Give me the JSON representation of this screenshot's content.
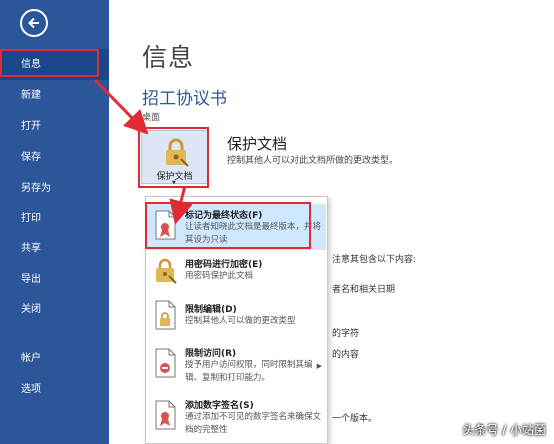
{
  "sidebar": {
    "back_icon": "back-arrow-icon",
    "items": [
      {
        "label": "信息",
        "active": true
      },
      {
        "label": "新建"
      },
      {
        "label": "打开"
      },
      {
        "label": "保存"
      },
      {
        "label": "另存为"
      },
      {
        "label": "打印"
      },
      {
        "label": "共享"
      },
      {
        "label": "导出"
      },
      {
        "label": "关闭"
      },
      {
        "label": "帐户"
      },
      {
        "label": "选项"
      }
    ]
  },
  "main": {
    "title": "信息",
    "document_title": "招工协议书",
    "location": "桌面",
    "protect": {
      "button_label": "保护文档",
      "heading": "保护文档",
      "description": "控制其他人可以对此文档所做的更改类型。"
    },
    "background_fragments": [
      "注意其包含以下内容:",
      "者名和相关日期",
      "的字符",
      "的内容",
      "一个版本。"
    ]
  },
  "menu": {
    "items": [
      {
        "title": "标记为最终状态(F)",
        "desc": "让读者知晓此文档是最终版本，并将其设为只读",
        "icon": "document-ribbon-icon",
        "highlighted": true
      },
      {
        "title": "用密码进行加密(E)",
        "desc": "用密码保护此文档",
        "icon": "lock-key-icon"
      },
      {
        "title": "限制编辑(D)",
        "desc": "控制其他人可以做的更改类型",
        "icon": "document-lock-icon"
      },
      {
        "title": "限制访问(R)",
        "desc": "授予用户访问权限，同时限制其编辑、复制和打印能力。",
        "icon": "document-restrict-icon",
        "has_submenu": true
      },
      {
        "title": "添加数字签名(S)",
        "desc": "通过添加不可见的数字签名来确保文档的完整性",
        "icon": "document-signature-icon"
      }
    ]
  },
  "watermark": "头条号 / 小站菌",
  "colors": {
    "sidebar": "#2b579a",
    "active": "#19478a",
    "highlight": "#cde8ff",
    "annotation": "#e02b36"
  }
}
